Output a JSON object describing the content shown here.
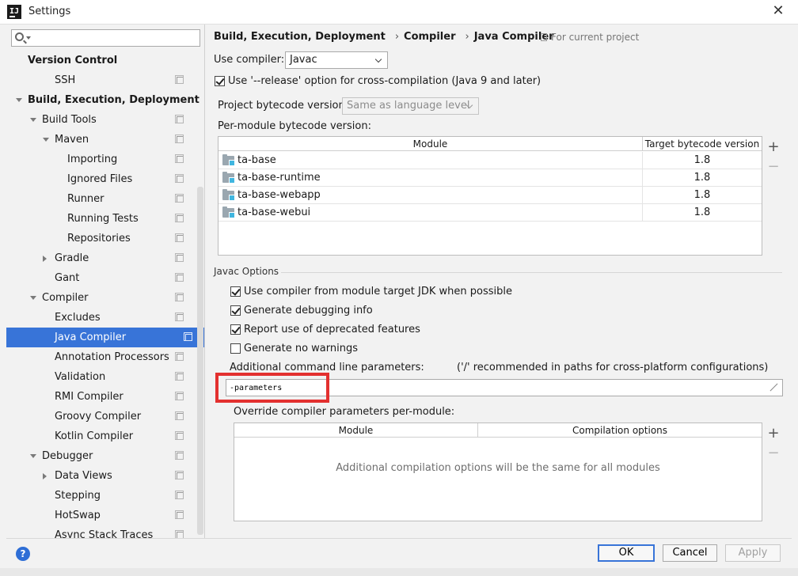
{
  "window": {
    "title": "Settings"
  },
  "search": {
    "placeholder": ""
  },
  "tree": [
    {
      "label": "Version Control",
      "bold": true,
      "level": 0,
      "arrow": "none",
      "copy": false
    },
    {
      "label": "SSH",
      "level": 2,
      "arrow": "none",
      "copy": true
    },
    {
      "label": "Build, Execution, Deployment",
      "bold": true,
      "level": 0,
      "arrow": "down",
      "copy": false
    },
    {
      "label": "Build Tools",
      "level": 1,
      "arrow": "down",
      "copy": true
    },
    {
      "label": "Maven",
      "level": 2,
      "arrow": "down",
      "copy": true
    },
    {
      "label": "Importing",
      "level": 3,
      "arrow": "none",
      "copy": true
    },
    {
      "label": "Ignored Files",
      "level": 3,
      "arrow": "none",
      "copy": true
    },
    {
      "label": "Runner",
      "level": 3,
      "arrow": "none",
      "copy": true
    },
    {
      "label": "Running Tests",
      "level": 3,
      "arrow": "none",
      "copy": true
    },
    {
      "label": "Repositories",
      "level": 3,
      "arrow": "none",
      "copy": true
    },
    {
      "label": "Gradle",
      "level": 2,
      "arrow": "right",
      "copy": true
    },
    {
      "label": "Gant",
      "level": 2,
      "arrow": "none",
      "copy": true
    },
    {
      "label": "Compiler",
      "level": 1,
      "arrow": "down",
      "copy": true
    },
    {
      "label": "Excludes",
      "level": 2,
      "arrow": "none",
      "copy": true
    },
    {
      "label": "Java Compiler",
      "level": 2,
      "arrow": "none",
      "copy": true,
      "selected": true
    },
    {
      "label": "Annotation Processors",
      "level": 2,
      "arrow": "none",
      "copy": true
    },
    {
      "label": "Validation",
      "level": 2,
      "arrow": "none",
      "copy": true
    },
    {
      "label": "RMI Compiler",
      "level": 2,
      "arrow": "none",
      "copy": true
    },
    {
      "label": "Groovy Compiler",
      "level": 2,
      "arrow": "none",
      "copy": true
    },
    {
      "label": "Kotlin Compiler",
      "level": 2,
      "arrow": "none",
      "copy": true
    },
    {
      "label": "Debugger",
      "level": 1,
      "arrow": "down",
      "copy": true
    },
    {
      "label": "Data Views",
      "level": 2,
      "arrow": "right",
      "copy": true
    },
    {
      "label": "Stepping",
      "level": 2,
      "arrow": "none",
      "copy": true
    },
    {
      "label": "HotSwap",
      "level": 2,
      "arrow": "none",
      "copy": true
    },
    {
      "label": "Async Stack Traces",
      "level": 2,
      "arrow": "none",
      "copy": true
    }
  ],
  "breadcrumb": [
    "Build, Execution, Deployment",
    "Compiler",
    "Java Compiler"
  ],
  "for_current_project": "For current project",
  "use_compiler": {
    "label": "Use compiler:",
    "value": "Javac"
  },
  "release_option": {
    "label": "Use '--release' option for cross-compilation (Java 9 and later)",
    "checked": true
  },
  "project_bytecode": {
    "label": "Project bytecode version:",
    "value": "Same as language level"
  },
  "per_module": {
    "label": "Per-module bytecode version:",
    "columns": [
      "Module",
      "Target bytecode version"
    ],
    "rows": [
      {
        "module": "ta-base",
        "target": "1.8"
      },
      {
        "module": "ta-base-runtime",
        "target": "1.8"
      },
      {
        "module": "ta-base-webapp",
        "target": "1.8"
      },
      {
        "module": "ta-base-webui",
        "target": "1.8"
      }
    ]
  },
  "javac": {
    "title": "Javac Options",
    "options": [
      {
        "label": "Use compiler from module target JDK when possible",
        "checked": true
      },
      {
        "label": "Generate debugging info",
        "checked": true
      },
      {
        "label": "Report use of deprecated features",
        "checked": true
      },
      {
        "label": "Generate no warnings",
        "checked": false
      }
    ],
    "additional_label": "Additional command line parameters:",
    "additional_hint": "('/' recommended in paths for cross-platform configurations)",
    "additional_value": "-parameters",
    "override_label": "Override compiler parameters per-module:",
    "override_columns": [
      "Module",
      "Compilation options"
    ],
    "override_empty": "Additional compilation options will be the same for all modules"
  },
  "side_buttons": {
    "add": "+",
    "remove": "−"
  },
  "buttons": {
    "help": "?",
    "ok": "OK",
    "cancel": "Cancel",
    "apply": "Apply"
  },
  "colors": {
    "selection": "#3874d8",
    "highlight": "#e3302f"
  }
}
